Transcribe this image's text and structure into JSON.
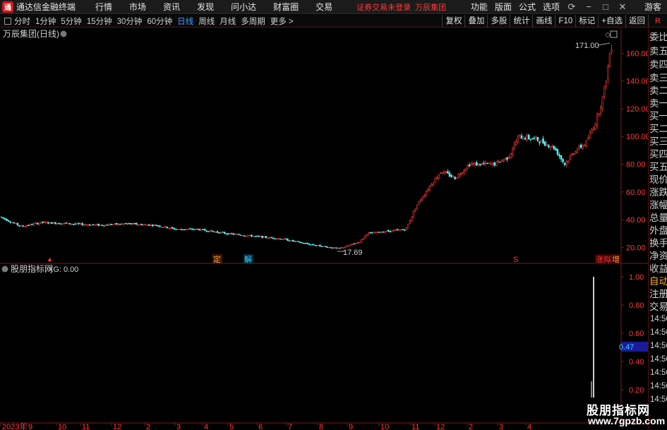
{
  "titlebar": {
    "logo_text": "通",
    "app_title": "通达信金融终端",
    "menu": [
      "行情",
      "市场",
      "资讯",
      "发现",
      "问小达",
      "财富圈",
      "交易"
    ],
    "login_status": "证券交易未登录",
    "stock_title": "万辰集团",
    "right_menu": [
      "功能",
      "版面",
      "公式",
      "选项"
    ],
    "guest": "游客"
  },
  "toolbar": {
    "periods": [
      "分时",
      "1分钟",
      "5分钟",
      "15分钟",
      "30分钟",
      "60分钟",
      "日线",
      "周线",
      "月线",
      "多周期",
      "更多 >"
    ],
    "active_period": "日线",
    "buttons": [
      "复权",
      "叠加",
      "多股",
      "统计",
      "画线",
      "F10",
      "标记",
      "+自选",
      "返回"
    ],
    "side_label": "R"
  },
  "right_panel": {
    "labels": [
      "委比",
      "卖五",
      "卖四",
      "卖三",
      "卖二",
      "卖一",
      "买一",
      "买二",
      "买三",
      "买四",
      "买五",
      "现价",
      "涨跌",
      "涨幅",
      "总量",
      "外盘",
      "换手",
      "净资",
      "收益"
    ],
    "lower_labels": [
      "自动",
      "注册",
      "交易"
    ],
    "times": [
      "14:56",
      "14:56",
      "14:56",
      "14:56",
      "14:56",
      "14:56",
      "14:56"
    ]
  },
  "main_chart": {
    "title": "万辰集团(日线)",
    "high_label": "171.00",
    "low_label": "17.69",
    "y_ticks": [
      "160.00",
      "140.00",
      "120.00",
      "100.00",
      "80.00",
      "60.00",
      "40.00",
      "20.00"
    ],
    "markers": [
      {
        "text": "定",
        "color": "#ff9a3a"
      },
      {
        "text": "解",
        "color": "#3ad0ff"
      },
      {
        "text": "S",
        "color": "#ff3a3a"
      },
      {
        "text": "涨拟",
        "color": "#ff3a3a"
      },
      {
        "text": "增",
        "color": "#ff9a3a"
      }
    ]
  },
  "indicator": {
    "title": "股朋指标网",
    "value_label": "XG: 0.00",
    "y_ticks": [
      "1.00",
      "0.80",
      "0.60",
      "0.40",
      "0.20"
    ],
    "current_value": "0.47"
  },
  "x_axis": {
    "labels": [
      "2023年",
      "9",
      "10",
      "11",
      "12",
      "2",
      "3",
      "4",
      "5",
      "6",
      "7",
      "8",
      "9",
      "10",
      "11",
      "12",
      "2",
      "3",
      "4"
    ]
  },
  "watermark": {
    "title": "股朋指标网",
    "url": "www.7gpzb.com"
  },
  "chart_data": {
    "type": "candlestick",
    "title": "万辰集团(日线)",
    "ylim": [
      12,
      176
    ],
    "y_ticks": [
      160,
      140,
      120,
      100,
      80,
      60,
      40,
      20
    ],
    "high": 171.0,
    "low": 17.69,
    "x_labels": [
      "2023年",
      "9",
      "10",
      "11",
      "12",
      "2",
      "3",
      "4",
      "5",
      "6",
      "7",
      "8",
      "9",
      "10",
      "11",
      "12",
      "2",
      "3",
      "4"
    ],
    "trend": [
      [
        0,
        42
      ],
      [
        30,
        35
      ],
      [
        60,
        38
      ],
      [
        100,
        37
      ],
      [
        140,
        36
      ],
      [
        180,
        37
      ],
      [
        220,
        36
      ],
      [
        250,
        33
      ],
      [
        280,
        33
      ],
      [
        320,
        30
      ],
      [
        360,
        28
      ],
      [
        400,
        26
      ],
      [
        440,
        22
      ],
      [
        480,
        19
      ],
      [
        510,
        24
      ],
      [
        520,
        30
      ],
      [
        575,
        33
      ],
      [
        590,
        50
      ],
      [
        610,
        65
      ],
      [
        625,
        75
      ],
      [
        645,
        70
      ],
      [
        665,
        80
      ],
      [
        700,
        80
      ],
      [
        720,
        85
      ],
      [
        735,
        100
      ],
      [
        760,
        98
      ],
      [
        785,
        92
      ],
      [
        800,
        80
      ],
      [
        815,
        90
      ],
      [
        830,
        95
      ],
      [
        845,
        112
      ],
      [
        855,
        130
      ],
      [
        862,
        152
      ],
      [
        866,
        168
      ],
      [
        869,
        150
      ]
    ]
  },
  "colors": {
    "up": "#ff3a3a",
    "down": "#54ffff",
    "axis_line": "#7a1a1a",
    "grid": "#7a1a1a",
    "accent_blue": "#3c9cff"
  }
}
